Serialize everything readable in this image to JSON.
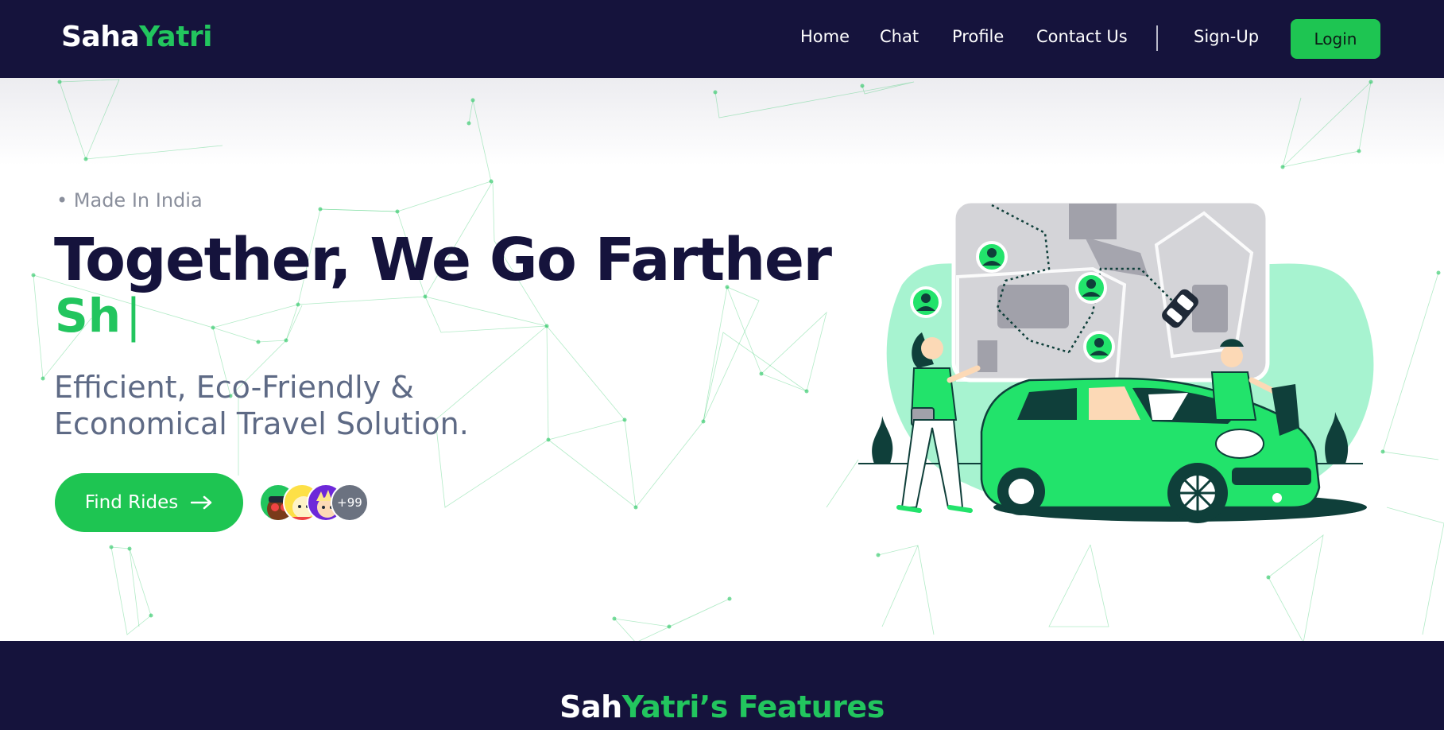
{
  "brand": {
    "first": "Saha",
    "second": "Yatri"
  },
  "nav": {
    "links": [
      "Home",
      "Chat",
      "Profile",
      "Contact Us"
    ],
    "signup": "Sign-Up",
    "login": "Login"
  },
  "hero": {
    "tagline": "• Made In India",
    "headline": "Together, We Go Farther",
    "typed_text": "Sh",
    "cursor": "|",
    "subtitle_line1": "Efficient, Eco-Friendly &",
    "subtitle_line2": "Economical Travel Solution.",
    "cta_label": "Find Rides",
    "cta_icon": "arrow-right-icon",
    "avatar_count": "+99"
  },
  "features": {
    "title_first": "Sah",
    "title_second": "Yatri’s Features"
  },
  "colors": {
    "navy": "#15133c",
    "green": "#22c55e",
    "button_green": "#1ec552",
    "mint": "#a7f3d0",
    "car_green": "#22e36b",
    "muted_text": "#5e6a85"
  }
}
